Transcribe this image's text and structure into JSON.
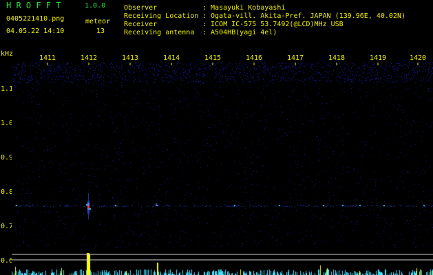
{
  "header": {
    "app_name": "H R O F F T",
    "version": "1.0.0",
    "filename": "0405221410.png",
    "datetime": "04.05.22 14:10",
    "meteor_label": "meteor",
    "meteor_count": "13",
    "info_labels": {
      "observer": "Observer",
      "location": "Receiving Location",
      "receiver": "Receiver",
      "antenna": "Receiving antenna"
    },
    "info_values": {
      "observer": ": Masayuki Kobayashi",
      "location": ": Ogata-vill. Akita-Pref. JAPAN (139.96E, 40.02N)",
      "receiver": ": ICOM IC-575 53.7492(@LCD)MHz USB",
      "antenna": ": A504HB(yagi 4el)"
    }
  },
  "axes": {
    "y_unit": "kHz",
    "x_ticks": [
      "1411",
      "1412",
      "1413",
      "1414",
      "1415",
      "1416",
      "1417",
      "1418",
      "1419",
      "1420"
    ],
    "y_ticks": [
      "1.1",
      "1.0",
      "0.9",
      "0.8",
      "0.7",
      "0.6"
    ]
  },
  "colors": {
    "text_yellow": "#f2f000",
    "text_green": "#2fe23a",
    "background": "#000000",
    "noise_blue": "#1a2aa0",
    "meteor_red": "#ff3030",
    "meteor_cyan": "#40e0ff",
    "bar_yellow": "#ffff00",
    "bar_cyan": "#40e0ff"
  }
}
